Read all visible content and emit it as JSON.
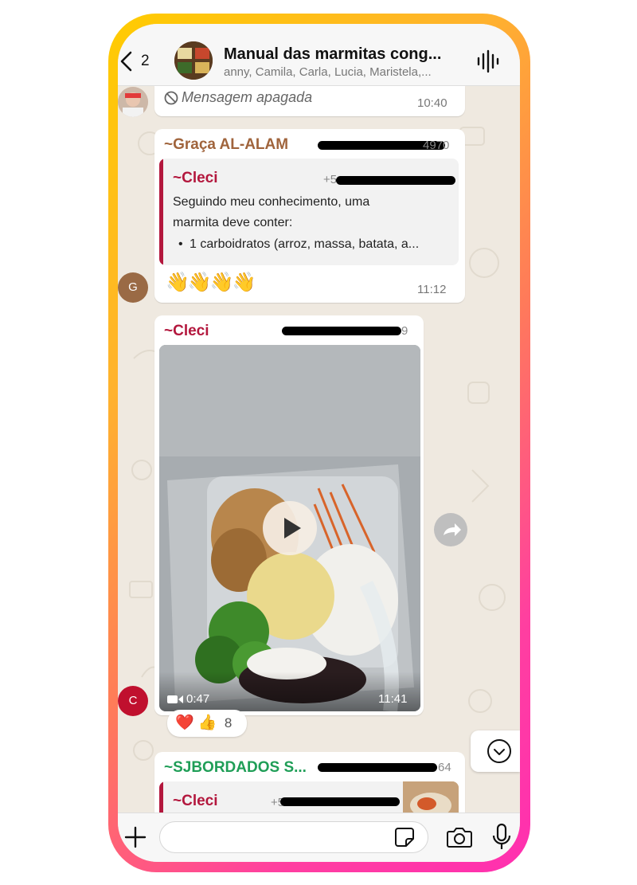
{
  "header": {
    "back_count": "2",
    "group_title": "Manual das marmitas cong...",
    "group_members": "anny, Camila, Carla, Lucia, Maristela,..."
  },
  "messages": {
    "deleted": {
      "text": "Mensagem apagada",
      "time": "10:40"
    },
    "m1": {
      "avatar_letter": "G",
      "sender": "~Graça AL-ALAM",
      "phone_fragment": "4970",
      "quote_sender": "~Cleci",
      "quote_phone_fragment": "+5",
      "quote_line1": "Seguindo meu conhecimento, uma",
      "quote_line2": "marmita deve conter:",
      "quote_bullet": "1 carboidratos (arroz, massa, batata, a...",
      "emojis": "👋👋👋👋",
      "time": "11:12"
    },
    "m2": {
      "avatar_letter": "C",
      "sender": "~Cleci",
      "phone_fragment": "9",
      "video_duration": "0:47",
      "time": "11:41",
      "reaction_emojis": "❤️ 👍",
      "reaction_count": "8"
    },
    "m3": {
      "sender": "~SJBORDADOS S...",
      "phone_fragment": "64",
      "quote_sender": "~Cleci",
      "quote_phone_fragment": "+5"
    }
  },
  "input": {
    "placeholder": ""
  },
  "colors": {
    "accent_red": "#b3173d",
    "sender_brown": "#a0643c",
    "sender_green": "#1f9e57",
    "avatar_g": "#9a6a45",
    "avatar_c": "#c0102e"
  }
}
